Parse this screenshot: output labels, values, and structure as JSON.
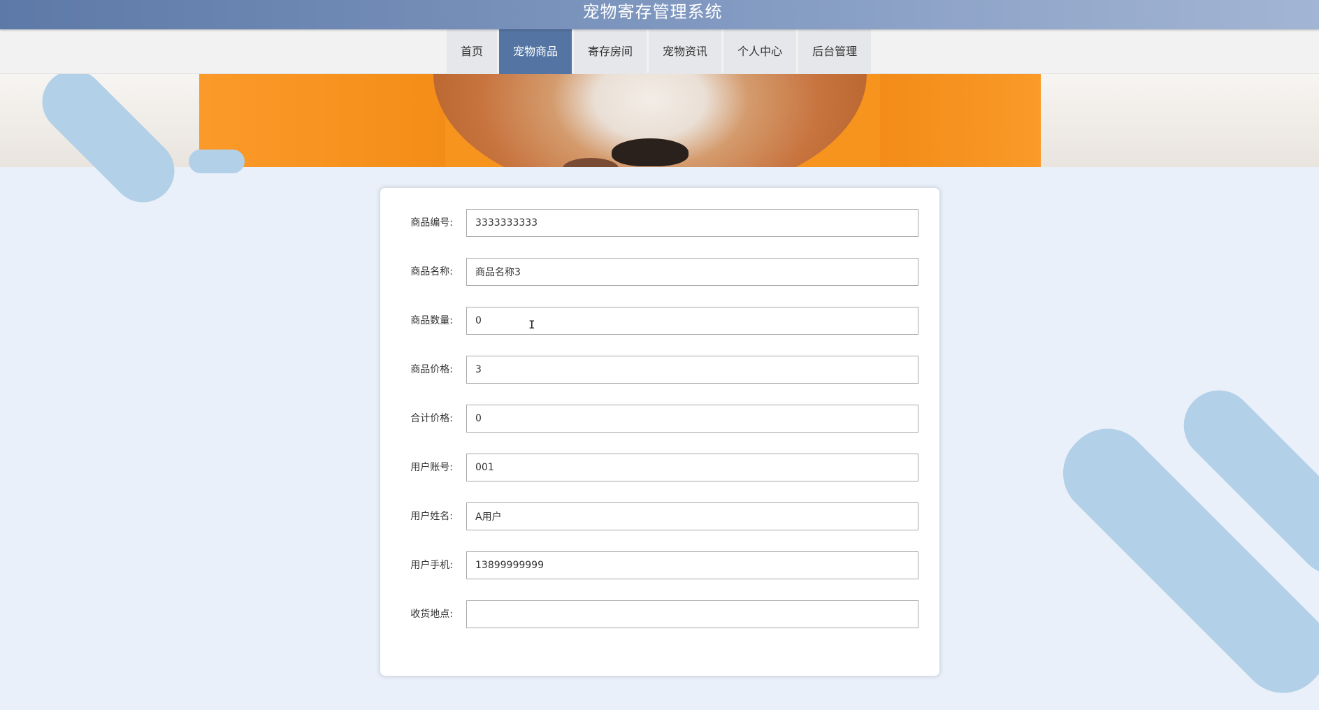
{
  "app": {
    "title": "宠物寄存管理系统"
  },
  "nav": {
    "items": [
      {
        "label": "首页",
        "active": false
      },
      {
        "label": "宠物商品",
        "active": true
      },
      {
        "label": "寄存房间",
        "active": false
      },
      {
        "label": "宠物资讯",
        "active": false
      },
      {
        "label": "个人中心",
        "active": false
      },
      {
        "label": "后台管理",
        "active": false
      }
    ]
  },
  "colors": {
    "header_gradient_start": "#5d79a7",
    "nav_active": "#5475a3",
    "page_background": "#eaf0f9",
    "decoration": "#b2d0e7"
  },
  "form": {
    "fields": [
      {
        "label": "商品编号:",
        "value": "3333333333"
      },
      {
        "label": "商品名称:",
        "value": "商品名称3"
      },
      {
        "label": "商品数量:",
        "value": "0"
      },
      {
        "label": "商品价格:",
        "value": "3"
      },
      {
        "label": "合计价格:",
        "value": "0"
      },
      {
        "label": "用户账号:",
        "value": "001"
      },
      {
        "label": "用户姓名:",
        "value": "A用户"
      },
      {
        "label": "用户手机:",
        "value": "13899999999"
      },
      {
        "label": "收货地点:",
        "value": ""
      }
    ]
  }
}
